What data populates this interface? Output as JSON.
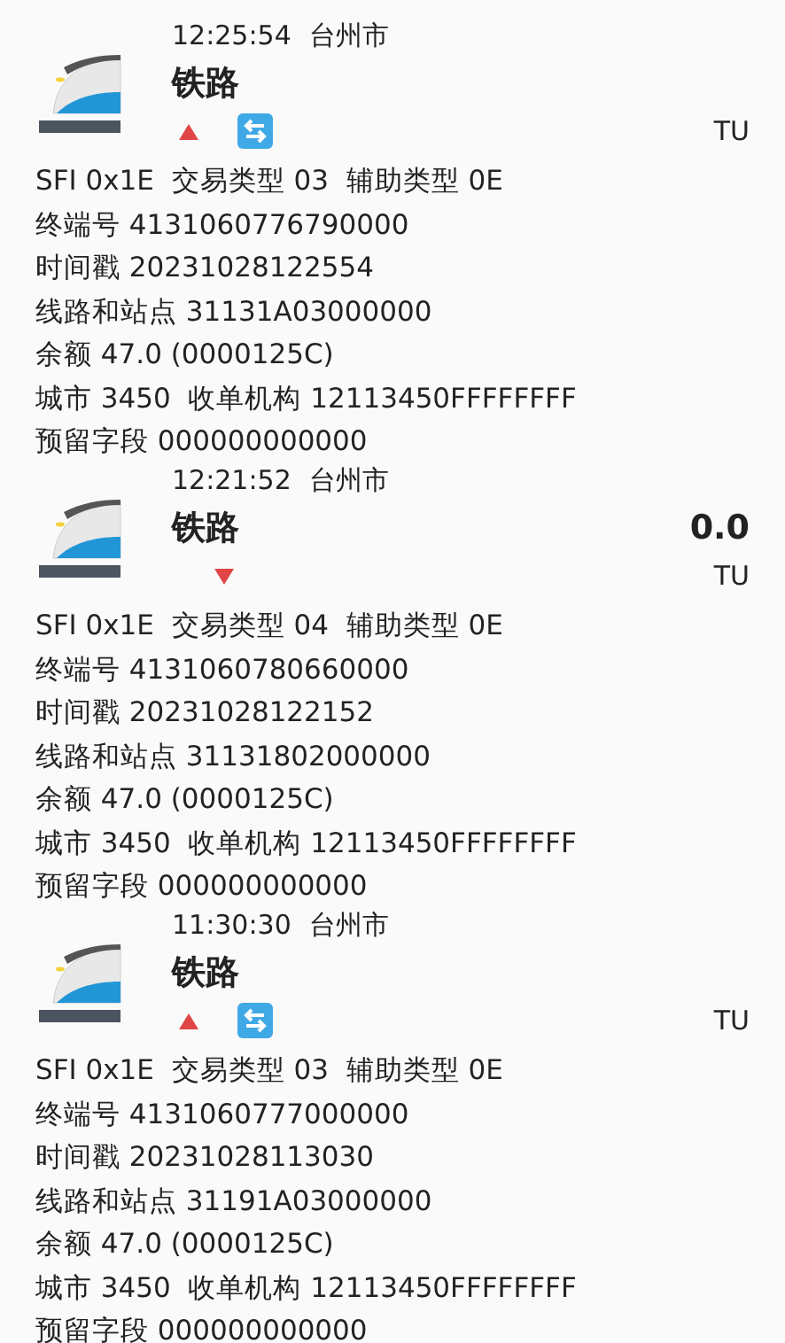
{
  "records": [
    {
      "time": "12:25:54",
      "city": "台州市",
      "title": "铁路",
      "kind": "up",
      "transfer": true,
      "unit": "TU",
      "lines": [
        "SFI 0x1E  交易类型 03  辅助类型 0E",
        "终端号 4131060776790000",
        "时间戳 20231028122554",
        "线路和站点 31131A03000000",
        "余额 47.0 (0000125C)",
        "城市 3450  收单机构 12113450FFFFFFFF",
        "预留字段 000000000000"
      ]
    },
    {
      "time": "12:21:52",
      "city": "台州市",
      "title": "铁路",
      "kind": "down",
      "transfer": false,
      "amount": "0.0",
      "unit": "TU",
      "lines": [
        "SFI 0x1E  交易类型 04  辅助类型 0E",
        "终端号 4131060780660000",
        "时间戳 20231028122152",
        "线路和站点 31131802000000",
        "余额 47.0 (0000125C)",
        "城市 3450  收单机构 12113450FFFFFFFF",
        "预留字段 000000000000"
      ]
    },
    {
      "time": "11:30:30",
      "city": "台州市",
      "title": "铁路",
      "kind": "up",
      "transfer": true,
      "unit": "TU",
      "lines": [
        "SFI 0x1E  交易类型 03  辅助类型 0E",
        "终端号 4131060777000000",
        "时间戳 20231028113030",
        "线路和站点 31191A03000000",
        "余额 47.0 (0000125C)",
        "城市 3450  收单机构 12113450FFFFFFFF",
        "预留字段 000000000000"
      ]
    }
  ]
}
